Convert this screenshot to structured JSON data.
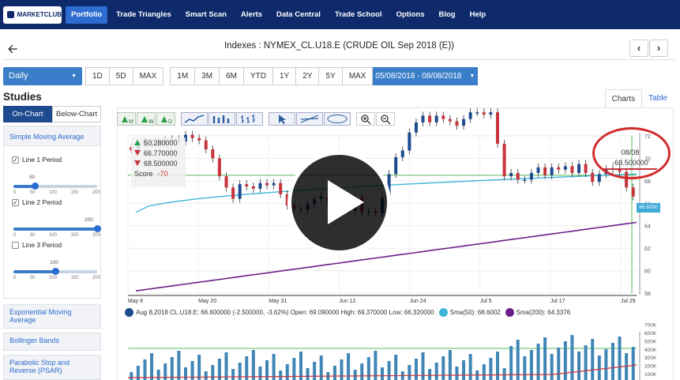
{
  "nav": {
    "logo": "MARKETCLUB",
    "items": [
      "Portfolio",
      "Trade Triangles",
      "Smart Scan",
      "Alerts",
      "Data Central",
      "Trade School",
      "Options",
      "Blog",
      "Help"
    ],
    "active": "Portfolio"
  },
  "header": {
    "title": "Indexes : NYMEX_CL.U18.E (CRUDE OIL Sep 2018 (E))",
    "back_icon": "arrow-left-icon",
    "prev_icon": "chevron-left-icon",
    "next_icon": "chevron-right-icon"
  },
  "range": {
    "interval": "Daily",
    "buttons_a": [
      "1D",
      "5D",
      "MAX"
    ],
    "buttons_b": [
      "1M",
      "3M",
      "6M",
      "YTD",
      "1Y",
      "2Y",
      "5Y",
      "MAX"
    ],
    "date_range": "05/08/2018 - 08/08/2018"
  },
  "studies": {
    "title": "Studies",
    "tabs": [
      "On-Chart",
      "Below-Chart"
    ],
    "sma": {
      "title": "Simple Moving Average",
      "line1": {
        "label": "Line 1 Period",
        "checked": true,
        "value": "50"
      },
      "line2": {
        "label": "Line 2 Period",
        "checked": true,
        "value": "200"
      },
      "line3": {
        "label": "Line 3 Period",
        "checked": false,
        "value": "100"
      },
      "ticks": [
        "0",
        "50",
        "100",
        "150",
        "200"
      ]
    },
    "others": [
      "Exponential Moving Average",
      "Bollinger Bands",
      "Parabolic Stop and Reverse (PSAR)"
    ]
  },
  "chart_tabs": [
    "Charts",
    "Table"
  ],
  "toolbar_labels": [
    "M",
    "W",
    "D"
  ],
  "info": {
    "up_value": "50.280000",
    "down1_value": "66.770000",
    "down2_value": "68.500000",
    "score_label": "Score",
    "score_value": "-70"
  },
  "callout": {
    "date": "08/08",
    "value": "-68.500000"
  },
  "last_price_tag": "66.6000",
  "legend": {
    "main": "Aug 8,2018 CL.U18.E: 66.600000 (-2.500000, -3.62%) Open: 69.090000 High: 69.370000 Low: 66.320000",
    "sma50": "Sma(50): 68.6002",
    "sma200": "Sma(200): 64.3376"
  },
  "colors": {
    "nav_bg": "#0e2a6b",
    "accent": "#3a7dc9",
    "up": "#2aa04a",
    "down": "#c9343b",
    "sma50": "#3fb5d9",
    "sma200": "#6b1f8a"
  },
  "chart_data": {
    "type": "candlestick",
    "x_tick_labels": [
      "May 8",
      "May 20",
      "May 31",
      "Jun 12",
      "Jun 24",
      "Jul 5",
      "Jul 17",
      "Jul 29"
    ],
    "y_ticks": [
      58,
      60,
      62,
      64,
      66,
      68,
      70,
      72
    ],
    "ylim": [
      58,
      72
    ],
    "volume_ticks": [
      "100K",
      "200K",
      "300K",
      "400K",
      "500K",
      "600K",
      "700K"
    ],
    "close": [
      70.7,
      71.3,
      71.5,
      71.4,
      71.3,
      71.6,
      71.7,
      71.5,
      72.1,
      71.8,
      71.6,
      70.8,
      70.0,
      68.4,
      67.4,
      66.4,
      67.7,
      67.5,
      67.3,
      67.8,
      67.6,
      67.8,
      66.8,
      65.8,
      65.5,
      65.4,
      65.9,
      66.4,
      66.6,
      66.1,
      65.8,
      65.6,
      65.3,
      66.5,
      65.2,
      65.3,
      65.1,
      66.5,
      68.6,
      70.1,
      70.7,
      72.3,
      73.2,
      73.8,
      73.2,
      73.8,
      73.5,
      73.3,
      72.9,
      73.5,
      74.1,
      74.1,
      73.9,
      74.1,
      71.3,
      68.4,
      68.7,
      68.1,
      68.1,
      68.7,
      69.2,
      68.5,
      69.2,
      69.0,
      69.3,
      68.7,
      69.5,
      68.7,
      67.9,
      68.6,
      69.0,
      69.1,
      68.8,
      67.4,
      66.6
    ],
    "sma50": {
      "start": 65.2,
      "end": 68.6
    },
    "sma200": {
      "start": 58.2,
      "end": 64.3
    }
  }
}
